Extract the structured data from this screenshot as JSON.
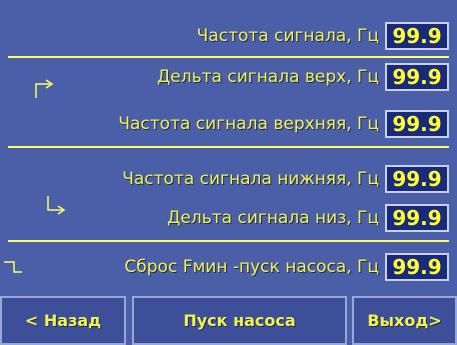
{
  "rows": [
    {
      "label": "Частота сигнала, Гц",
      "value": "99.9"
    },
    {
      "label": "Дельта сигнала верх, Гц",
      "value": "99.9"
    },
    {
      "label": "Частота сигнала верхняя, Гц",
      "value": "99.9"
    },
    {
      "label": "Частота сигнала нижняя, Гц",
      "value": "99.9"
    },
    {
      "label": "Дельта сигнала низ, Гц",
      "value": "99.9"
    },
    {
      "label": "Сброс Fмин -пуск насоса, Гц",
      "value": "99.9"
    }
  ],
  "buttons": {
    "back": "< Назад",
    "start_pump": "Пуск насоса",
    "exit": "Выход>"
  },
  "icons": [
    "arrow-up-right-icon",
    "arrow-down-right-icon",
    "reset-icon"
  ]
}
